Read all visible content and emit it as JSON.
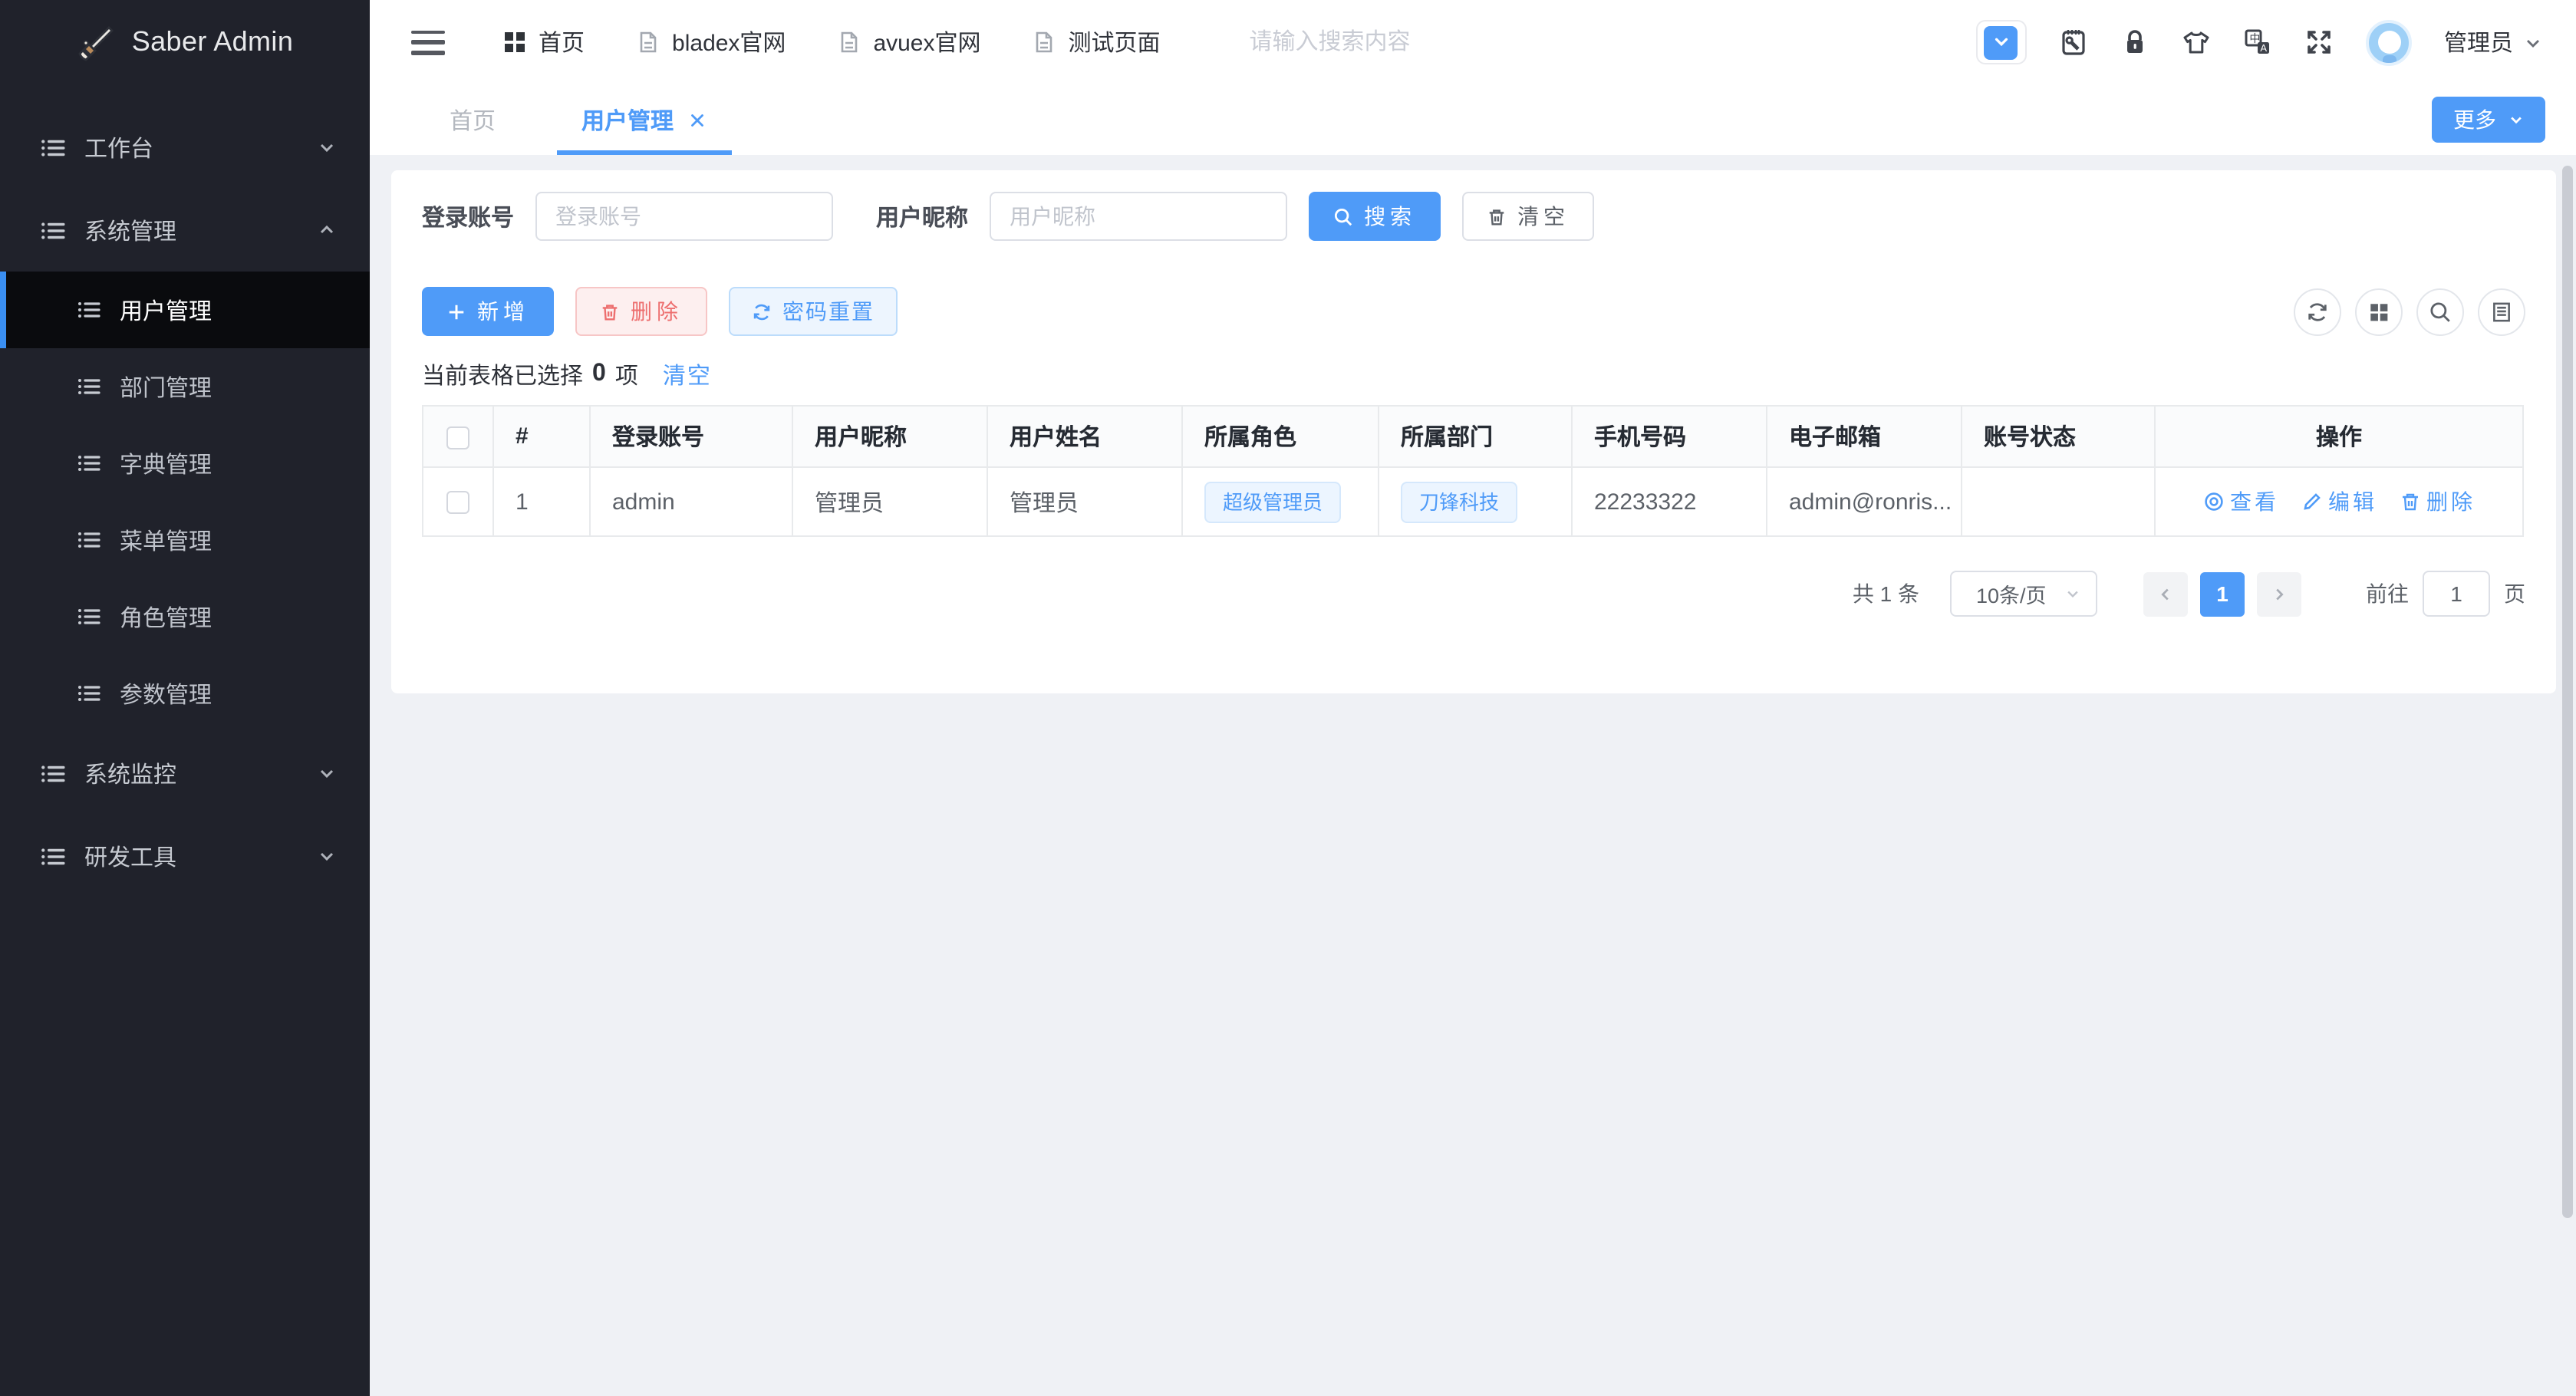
{
  "app_title": "Saber Admin",
  "colors": {
    "accent_blue": "#4f9bf8",
    "sidebar_bg": "#20222b",
    "active_item_bg": "#0a0b0e",
    "page_bg": "#eff1f5",
    "danger_text": "#ed6f6f",
    "tag_bg": "#ecf5ff"
  },
  "sidebar": {
    "logo_text": "Saber Admin",
    "items": [
      {
        "label": "工作台",
        "icon": "menu-list-icon",
        "state": "collapsed"
      },
      {
        "label": "系统管理",
        "icon": "menu-list-icon",
        "state": "expanded",
        "children": [
          {
            "label": "用户管理",
            "active": true
          },
          {
            "label": "部门管理"
          },
          {
            "label": "字典管理"
          },
          {
            "label": "菜单管理"
          },
          {
            "label": "角色管理"
          },
          {
            "label": "参数管理"
          }
        ]
      },
      {
        "label": "系统监控",
        "icon": "menu-list-icon",
        "state": "collapsed"
      },
      {
        "label": "研发工具",
        "icon": "menu-list-icon",
        "state": "collapsed"
      }
    ]
  },
  "header": {
    "nav": [
      {
        "label": "首页",
        "icon": "grid-icon"
      },
      {
        "label": "bladex官网",
        "icon": "document-icon"
      },
      {
        "label": "avuex官网",
        "icon": "document-icon"
      },
      {
        "label": "测试页面",
        "icon": "document-icon"
      }
    ],
    "search_placeholder": "请输入搜索内容",
    "icons": [
      "menu-collapse-toggle-icon",
      "debug-clipboard-icon",
      "lock-icon",
      "theme-shirt-icon",
      "language-icon",
      "fullscreen-icon"
    ],
    "user_name": "管理员"
  },
  "tabbar": {
    "tabs": [
      {
        "label": "首页"
      },
      {
        "label": "用户管理",
        "active": true,
        "closable": true
      }
    ],
    "more_label": "更多"
  },
  "filters": {
    "account_label": "登录账号",
    "account_placeholder": "登录账号",
    "nickname_label": "用户昵称",
    "nickname_placeholder": "用户昵称",
    "search_label": "搜索",
    "clear_label": "清空"
  },
  "actions": {
    "add": "新增",
    "delete": "删除",
    "reset_password": "密码重置"
  },
  "selection": {
    "prefix": "当前表格已选择",
    "count": "0",
    "suffix": "项",
    "clear": "清空"
  },
  "table": {
    "columns": [
      "#",
      "登录账号",
      "用户昵称",
      "用户姓名",
      "所属角色",
      "所属部门",
      "手机号码",
      "电子邮箱",
      "账号状态",
      "操作"
    ],
    "row": {
      "index": "1",
      "account": "admin",
      "nickname": "管理员",
      "name": "管理员",
      "role": "超级管理员",
      "dept": "刀锋科技",
      "phone": "22233322",
      "email": "admin@ronris...",
      "status": "",
      "ops": {
        "view": "查看",
        "edit": "编辑",
        "delete": "删除"
      }
    }
  },
  "pagination": {
    "total": "共 1 条",
    "page_size": "10条/页",
    "page": "1",
    "goto_label": "前往",
    "goto_value": "1",
    "unit_label": "页"
  }
}
